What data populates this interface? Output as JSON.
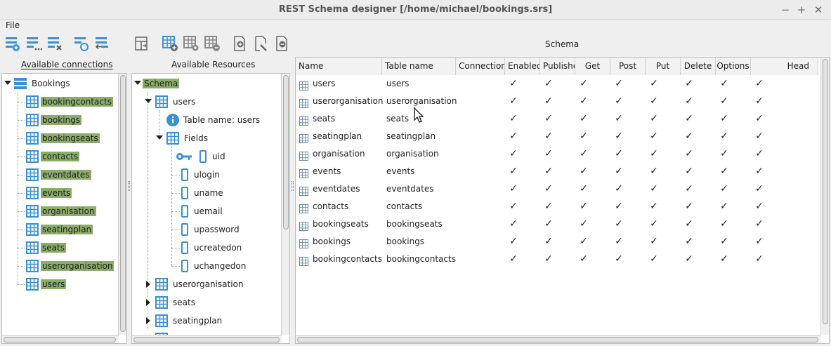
{
  "window": {
    "title": "REST Schema designer [/home/michael/bookings.srs]"
  },
  "menu": {
    "file": "File"
  },
  "headers": {
    "available_connections": "Available connections",
    "available_resources": "Available Resources",
    "schema": "Schema"
  },
  "connections": {
    "root": "Bookings",
    "items": [
      "bookingcontacts",
      "bookings",
      "bookingseats",
      "contacts",
      "eventdates",
      "events",
      "organisation",
      "seatingplan",
      "seats",
      "userorganisation",
      "users"
    ]
  },
  "resources": {
    "root": "Schema",
    "users": "users",
    "table_name_info": "Table name: users",
    "fields_label": "Fields",
    "fields": [
      "uid",
      "ulogin",
      "uname",
      "uemail",
      "upassword",
      "ucreatedon",
      "uchangedon"
    ],
    "collapsed": [
      "userorganisation",
      "seats",
      "seatingplan"
    ]
  },
  "schema": {
    "columns": [
      "Name",
      "Table name",
      "Connection",
      "Enabled",
      "Published",
      "Get",
      "Post",
      "Put",
      "Delete",
      "Options",
      "Head"
    ],
    "check": "✓",
    "rows": [
      {
        "name": "users",
        "table": "users"
      },
      {
        "name": "userorganisation",
        "table": "userorganisation"
      },
      {
        "name": "seats",
        "table": "seats"
      },
      {
        "name": "seatingplan",
        "table": "seatingplan"
      },
      {
        "name": "organisation",
        "table": "organisation"
      },
      {
        "name": "events",
        "table": "events"
      },
      {
        "name": "eventdates",
        "table": "eventdates"
      },
      {
        "name": "contacts",
        "table": "contacts"
      },
      {
        "name": "bookingseats",
        "table": "bookingseats"
      },
      {
        "name": "bookings",
        "table": "bookings"
      },
      {
        "name": "bookingcontacts",
        "table": "bookingcontacts"
      }
    ]
  },
  "colors": {
    "highlight": "#8cac6a",
    "icon": "#3a8fd6"
  }
}
